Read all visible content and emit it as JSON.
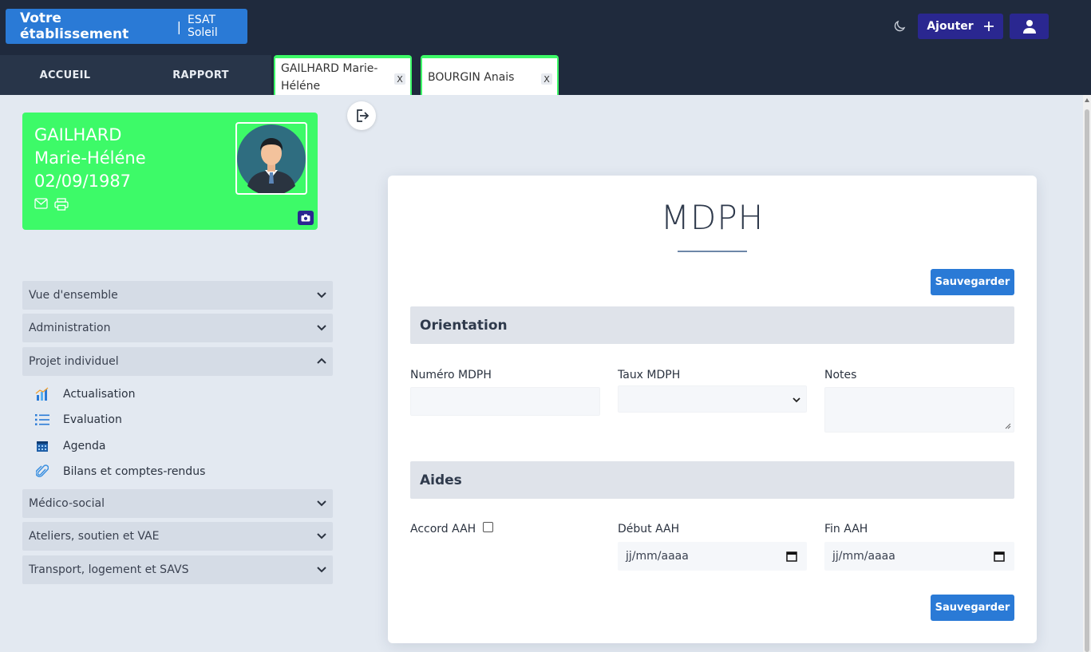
{
  "header": {
    "brand_name": "Votre établissement",
    "brand_separator": "|",
    "establishment": "ESAT Soleil",
    "add_label": "Ajouter",
    "icons": [
      "moon-icon",
      "plus-icon",
      "user-icon"
    ]
  },
  "nav": {
    "tabs": [
      {
        "label": "ACCUEIL"
      },
      {
        "label": "RAPPORT"
      }
    ],
    "open_records": [
      {
        "label_line1": "GAILHARD Marie-",
        "label_line2": "Héléne",
        "close": "X"
      },
      {
        "label": "BOURGIN Anais",
        "close": "X"
      }
    ],
    "tab_accent": "#3dfa68"
  },
  "profile": {
    "last_name": "GAILHARD",
    "first_name": "Marie-Héléne",
    "birth_date": "02/09/1987",
    "card_color": "#3dfa68",
    "icons": [
      "mail-icon",
      "print-icon",
      "camera-icon",
      "avatar"
    ]
  },
  "sidebar": {
    "sections": [
      {
        "label": "Vue d'ensemble",
        "expanded": false
      },
      {
        "label": "Administration",
        "expanded": false
      },
      {
        "label": "Projet individuel",
        "expanded": true
      },
      {
        "label": "Médico-social",
        "expanded": false
      },
      {
        "label": "Ateliers, soutien et VAE",
        "expanded": false
      },
      {
        "label": "Transport, logement et SAVS",
        "expanded": false
      }
    ],
    "sub_items": [
      {
        "label": "Actualisation",
        "icon": "chart-icon"
      },
      {
        "label": "Evaluation",
        "icon": "list-icon"
      },
      {
        "label": "Agenda",
        "icon": "calendar-icon"
      },
      {
        "label": "Bilans et comptes-rendus",
        "icon": "paperclip-icon"
      }
    ]
  },
  "main": {
    "title": "MDPH",
    "save_label": "Sauvegarder",
    "orientation": {
      "heading": "Orientation",
      "numero_label": "Numéro MDPH",
      "numero_value": "",
      "taux_label": "Taux MDPH",
      "taux_value": "",
      "notes_label": "Notes",
      "notes_value": ""
    },
    "aides": {
      "heading": "Aides",
      "accord_label": "Accord AAH",
      "accord_checked": false,
      "debut_label": "Début AAH",
      "debut_placeholder": "jj/mm/aaaa",
      "fin_label": "Fin AAH",
      "fin_placeholder": "jj/mm/aaaa"
    }
  },
  "colors": {
    "topbar": "#1f2a3d",
    "primary": "#2a7ad6",
    "indigo": "#2a2790"
  }
}
